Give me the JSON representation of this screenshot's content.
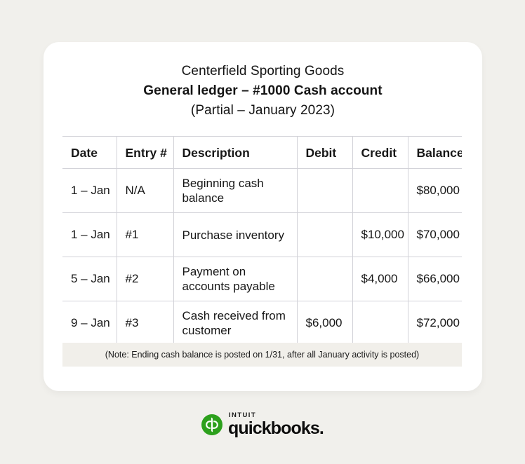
{
  "page": {
    "background_color": "#F1F0EC",
    "card_background": "#FFFFFF"
  },
  "card": {
    "titles": {
      "company": "Centerfield Sporting Goods",
      "report": "General ledger – #1000 Cash account",
      "period": "(Partial – January 2023)"
    },
    "table": {
      "columns": [
        "Date",
        "Entry #",
        "Description",
        "Debit",
        "Credit",
        "Balance"
      ],
      "rows": [
        {
          "date": "1 – Jan",
          "entry": "N/A",
          "description": "Beginning cash balance",
          "debit": "",
          "credit": "",
          "balance": "$80,000"
        },
        {
          "date": "1 – Jan",
          "entry": "#1",
          "description": "Purchase inventory",
          "debit": "",
          "credit": "$10,000",
          "balance": "$70,000"
        },
        {
          "date": "5 – Jan",
          "entry": "#2",
          "description": "Payment on accounts payable",
          "debit": "",
          "credit": "$4,000",
          "balance": "$66,000"
        },
        {
          "date": "9 – Jan",
          "entry": "#3",
          "description": "Cash received from customer",
          "debit": "$6,000",
          "credit": "",
          "balance": "$72,000"
        }
      ]
    },
    "note": {
      "text": "(Note: Ending cash balance is posted on 1/31, after all January activity is posted)",
      "background_color": "#F1EFEA"
    }
  },
  "logo": {
    "mark_name": "quickbooks-qb-circle-icon",
    "mark_color": "#2CA01C",
    "brand_small": "INTUIT",
    "brand_main": "quickbooks."
  }
}
